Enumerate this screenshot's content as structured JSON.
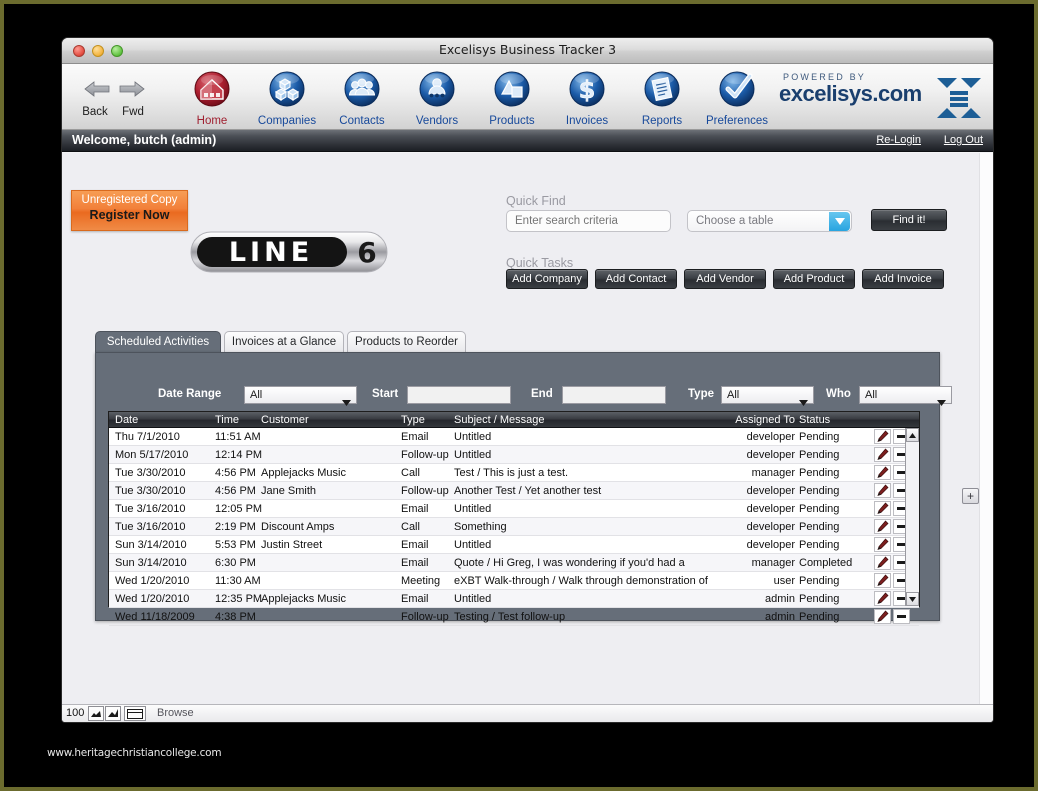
{
  "window": {
    "title": "Excelisys Business Tracker 3",
    "traffic_lights": [
      "close",
      "minimize",
      "maximize"
    ]
  },
  "toolbar": {
    "nav": {
      "back_label": "Back",
      "fwd_label": "Fwd"
    },
    "items": [
      {
        "label": "Home",
        "icon": "house-icon",
        "color": "#a02030",
        "active": true
      },
      {
        "label": "Companies",
        "icon": "blocks-icon",
        "color": "#17499b",
        "active": false
      },
      {
        "label": "Contacts",
        "icon": "people-icon",
        "color": "#17499b",
        "active": false
      },
      {
        "label": "Vendors",
        "icon": "vendor-icon",
        "color": "#17499b",
        "active": false
      },
      {
        "label": "Products",
        "icon": "products-icon",
        "color": "#17499b",
        "active": false
      },
      {
        "label": "Invoices",
        "icon": "dollar-icon",
        "color": "#17499b",
        "active": false
      },
      {
        "label": "Reports",
        "icon": "report-icon",
        "color": "#17499b",
        "active": false
      },
      {
        "label": "Preferences",
        "icon": "checkmark-icon",
        "color": "#17499b",
        "active": false
      }
    ],
    "powered_by": {
      "top": "POWERED BY",
      "brand": "excelisys.com",
      "logo": "excelisys-x-logo"
    }
  },
  "welcome_bar": {
    "greeting": "Welcome, butch (admin)",
    "relogin": "Re-Login",
    "logout": "Log Out"
  },
  "register_badge": {
    "line1": "Unregistered Copy",
    "line2": "Register Now",
    "bg": "#ef8034"
  },
  "company_logo": {
    "name": "LINE",
    "digit": "6"
  },
  "quick_find": {
    "label": "Quick Find",
    "search_placeholder": "Enter search criteria",
    "search_value": "",
    "table_select_value": "Choose a table",
    "find_button": "Find it!"
  },
  "quick_tasks": {
    "label": "Quick Tasks",
    "buttons": [
      "Add Company",
      "Add Contact",
      "Add Vendor",
      "Add Product",
      "Add Invoice"
    ]
  },
  "tabs": [
    {
      "label": "Scheduled Activities",
      "active": true
    },
    {
      "label": "Invoices at a Glance",
      "active": false
    },
    {
      "label": "Products to Reorder",
      "active": false
    }
  ],
  "filters": {
    "date_range_label": "Date Range",
    "date_range_value": "All",
    "start_label": "Start",
    "start_value": "",
    "end_label": "End",
    "end_value": "",
    "type_label": "Type",
    "type_value": "All",
    "who_label": "Who",
    "who_value": "All",
    "add_button": "+"
  },
  "grid": {
    "columns": [
      "Date",
      "Time",
      "Customer",
      "Type",
      "Subject / Message",
      "Assigned To",
      "Status"
    ],
    "rows": [
      {
        "date": "Thu 7/1/2010",
        "time": "11:51 AM",
        "customer": "",
        "type": "Email",
        "subject": "Untitled",
        "assigned": "developer",
        "status": "Pending"
      },
      {
        "date": "Mon 5/17/2010",
        "time": "12:14 PM",
        "customer": "",
        "type": "Follow-up",
        "subject": "Untitled",
        "assigned": "developer",
        "status": "Pending"
      },
      {
        "date": "Tue 3/30/2010",
        "time": "4:56 PM",
        "customer": "Applejacks Music",
        "type": "Call",
        "subject": "Test / This is just a test.",
        "assigned": "manager",
        "status": "Pending"
      },
      {
        "date": "Tue 3/30/2010",
        "time": "4:56 PM",
        "customer": "Jane Smith",
        "type": "Follow-up",
        "subject": "Another Test / Yet another test",
        "assigned": "developer",
        "status": "Pending"
      },
      {
        "date": "Tue 3/16/2010",
        "time": "12:05 PM",
        "customer": "",
        "type": "Email",
        "subject": "Untitled",
        "assigned": "developer",
        "status": "Pending"
      },
      {
        "date": "Tue 3/16/2010",
        "time": "2:19 PM",
        "customer": "Discount Amps",
        "type": "Call",
        "subject": "Something",
        "assigned": "developer",
        "status": "Pending"
      },
      {
        "date": "Sun 3/14/2010",
        "time": "5:53 PM",
        "customer": "Justin Street",
        "type": "Email",
        "subject": "Untitled",
        "assigned": "developer",
        "status": "Pending"
      },
      {
        "date": "Sun 3/14/2010",
        "time": "6:30 PM",
        "customer": "",
        "type": "Email",
        "subject": "Quote / Hi Greg,  I was wondering if you'd had a",
        "assigned": "manager",
        "status": "Completed"
      },
      {
        "date": "Wed 1/20/2010",
        "time": "11:30 AM",
        "customer": "",
        "type": "Meeting",
        "subject": "eXBT Walk-through / Walk through demonstration of",
        "assigned": "user",
        "status": "Pending"
      },
      {
        "date": "Wed 1/20/2010",
        "time": "12:35 PM",
        "customer": "Applejacks Music",
        "type": "Email",
        "subject": "Untitled",
        "assigned": "admin",
        "status": "Pending"
      },
      {
        "date": "Wed 11/18/2009",
        "time": "4:38 PM",
        "customer": "",
        "type": "Follow-up",
        "subject": "Testing / Test follow-up",
        "assigned": "admin",
        "status": "Pending"
      }
    ],
    "row_actions": {
      "edit": "pencil-icon",
      "delete": "minus-icon"
    }
  },
  "status_bar": {
    "zoom": "100",
    "mode": "Browse",
    "icons": [
      "zoom-out-icon",
      "zoom-in-icon",
      "layout-toggle-icon"
    ]
  },
  "watermark": "www.heritagechristiancollege.com"
}
